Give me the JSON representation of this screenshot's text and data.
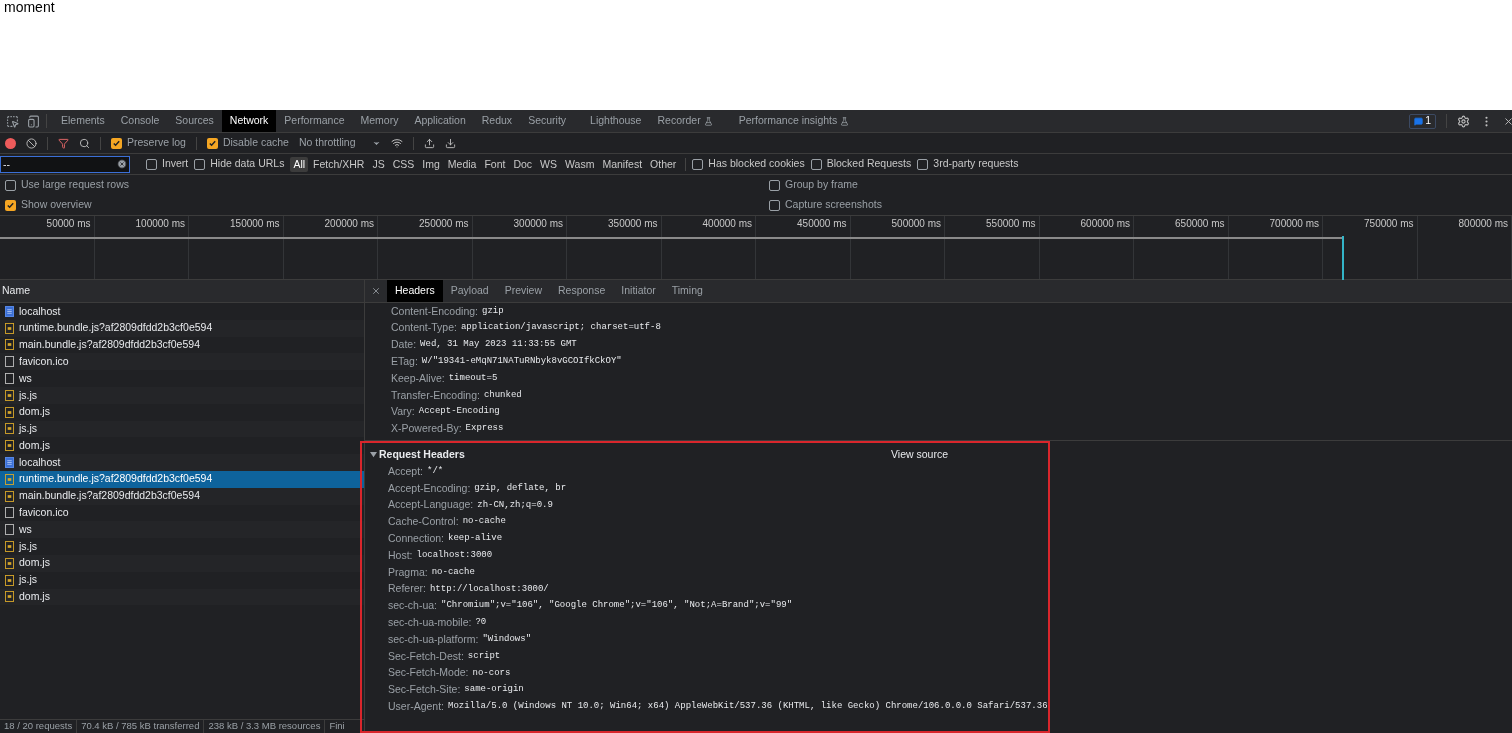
{
  "page": {
    "text": "moment"
  },
  "tabs": [
    {
      "label": "Elements",
      "selected": false,
      "experimental": false
    },
    {
      "label": "Console",
      "selected": false,
      "experimental": false
    },
    {
      "label": "Sources",
      "selected": false,
      "experimental": false
    },
    {
      "label": "Network",
      "selected": true,
      "experimental": false
    },
    {
      "label": "Performance",
      "selected": false,
      "experimental": false
    },
    {
      "label": "Memory",
      "selected": false,
      "experimental": false
    },
    {
      "label": "Application",
      "selected": false,
      "experimental": false
    },
    {
      "label": "Redux",
      "selected": false,
      "experimental": false
    },
    {
      "label": "Security",
      "selected": false,
      "experimental": false
    },
    {
      "label": "Lighthouse",
      "selected": false,
      "experimental": false
    },
    {
      "label": "Recorder",
      "selected": false,
      "experimental": true
    },
    {
      "label": "Performance insights",
      "selected": false,
      "experimental": true
    }
  ],
  "issues_count": "1",
  "toolbar": {
    "recording": true,
    "preserve_log": {
      "label": "Preserve log",
      "checked": true
    },
    "disable_cache": {
      "label": "Disable cache",
      "checked": true
    },
    "throttling": "No throttling"
  },
  "filter": {
    "value": "--",
    "invert": {
      "label": "Invert",
      "checked": false
    },
    "hide_data_urls": {
      "label": "Hide data URLs",
      "checked": false
    },
    "types": [
      {
        "label": "All",
        "selected": true
      },
      {
        "label": "Fetch/XHR",
        "selected": false
      },
      {
        "label": "JS",
        "selected": false
      },
      {
        "label": "CSS",
        "selected": false
      },
      {
        "label": "Img",
        "selected": false
      },
      {
        "label": "Media",
        "selected": false
      },
      {
        "label": "Font",
        "selected": false
      },
      {
        "label": "Doc",
        "selected": false
      },
      {
        "label": "WS",
        "selected": false
      },
      {
        "label": "Wasm",
        "selected": false
      },
      {
        "label": "Manifest",
        "selected": false
      },
      {
        "label": "Other",
        "selected": false
      }
    ],
    "extra": [
      {
        "label": "Has blocked cookies",
        "checked": false
      },
      {
        "label": "Blocked Requests",
        "checked": false
      },
      {
        "label": "3rd-party requests",
        "checked": false
      }
    ]
  },
  "settings_left": [
    {
      "label": "Use large request rows",
      "checked": false
    },
    {
      "label": "Show overview",
      "checked": true
    }
  ],
  "settings_right": [
    {
      "label": "Group by frame",
      "checked": false
    },
    {
      "label": "Capture screenshots",
      "checked": false
    }
  ],
  "timeline_ticks": [
    "50000 ms",
    "100000 ms",
    "150000 ms",
    "200000 ms",
    "250000 ms",
    "300000 ms",
    "350000 ms",
    "400000 ms",
    "450000 ms",
    "500000 ms",
    "550000 ms",
    "600000 ms",
    "650000 ms",
    "700000 ms",
    "750000 ms",
    "800000 ms"
  ],
  "list_header": "Name",
  "requests": [
    {
      "name": "localhost",
      "kind": "doc",
      "selected": false
    },
    {
      "name": "runtime.bundle.js?af2809dfdd2b3cf0e594",
      "kind": "script",
      "selected": false
    },
    {
      "name": "main.bundle.js?af2809dfdd2b3cf0e594",
      "kind": "script",
      "selected": false
    },
    {
      "name": "favicon.ico",
      "kind": "other",
      "selected": false
    },
    {
      "name": "ws",
      "kind": "other",
      "selected": false
    },
    {
      "name": "js.js",
      "kind": "script",
      "selected": false
    },
    {
      "name": "dom.js",
      "kind": "script",
      "selected": false
    },
    {
      "name": "js.js",
      "kind": "script",
      "selected": false
    },
    {
      "name": "dom.js",
      "kind": "script",
      "selected": false
    },
    {
      "name": "localhost",
      "kind": "doc",
      "selected": false
    },
    {
      "name": "runtime.bundle.js?af2809dfdd2b3cf0e594",
      "kind": "script",
      "selected": true
    },
    {
      "name": "main.bundle.js?af2809dfdd2b3cf0e594",
      "kind": "script",
      "selected": false
    },
    {
      "name": "favicon.ico",
      "kind": "other",
      "selected": false
    },
    {
      "name": "ws",
      "kind": "other",
      "selected": false
    },
    {
      "name": "js.js",
      "kind": "script",
      "selected": false
    },
    {
      "name": "dom.js",
      "kind": "script",
      "selected": false
    },
    {
      "name": "js.js",
      "kind": "script",
      "selected": false
    },
    {
      "name": "dom.js",
      "kind": "script",
      "selected": false
    }
  ],
  "status_bar": [
    "18 / 20 requests",
    "70.4 kB / 785 kB transferred",
    "238 kB / 3.3 MB resources",
    "Fini"
  ],
  "detail_tabs": [
    {
      "label": "Headers",
      "selected": true
    },
    {
      "label": "Payload",
      "selected": false
    },
    {
      "label": "Preview",
      "selected": false
    },
    {
      "label": "Response",
      "selected": false
    },
    {
      "label": "Initiator",
      "selected": false
    },
    {
      "label": "Timing",
      "selected": false
    }
  ],
  "response_headers": [
    {
      "name": "Content-Encoding:",
      "value": "gzip"
    },
    {
      "name": "Content-Type:",
      "value": "application/javascript; charset=utf-8"
    },
    {
      "name": "Date:",
      "value": "Wed, 31 May 2023 11:33:55 GMT"
    },
    {
      "name": "ETag:",
      "value": "W/\"19341-eMqN71NATuRNbyk8vGCOIfkCkOY\""
    },
    {
      "name": "Keep-Alive:",
      "value": "timeout=5"
    },
    {
      "name": "Transfer-Encoding:",
      "value": "chunked"
    },
    {
      "name": "Vary:",
      "value": "Accept-Encoding"
    },
    {
      "name": "X-Powered-By:",
      "value": "Express"
    }
  ],
  "request_headers": {
    "title": "Request Headers",
    "expanded": true,
    "view_source": "View source",
    "headers": [
      {
        "name": "Accept:",
        "value": "*/*"
      },
      {
        "name": "Accept-Encoding:",
        "value": "gzip, deflate, br"
      },
      {
        "name": "Accept-Language:",
        "value": "zh-CN,zh;q=0.9"
      },
      {
        "name": "Cache-Control:",
        "value": "no-cache"
      },
      {
        "name": "Connection:",
        "value": "keep-alive"
      },
      {
        "name": "Host:",
        "value": "localhost:3000"
      },
      {
        "name": "Pragma:",
        "value": "no-cache"
      },
      {
        "name": "Referer:",
        "value": "http://localhost:3000/"
      },
      {
        "name": "sec-ch-ua:",
        "value": "\"Chromium\";v=\"106\", \"Google Chrome\";v=\"106\", \"Not;A=Brand\";v=\"99\""
      },
      {
        "name": "sec-ch-ua-mobile:",
        "value": "?0"
      },
      {
        "name": "sec-ch-ua-platform:",
        "value": "\"Windows\""
      },
      {
        "name": "Sec-Fetch-Dest:",
        "value": "script"
      },
      {
        "name": "Sec-Fetch-Mode:",
        "value": "no-cors"
      },
      {
        "name": "Sec-Fetch-Site:",
        "value": "same-origin"
      },
      {
        "name": "User-Agent:",
        "value": "Mozilla/5.0 (Windows NT 10.0; Win64; x64) AppleWebKit/537.36 (KHTML, like Gecko) Chrome/106.0.0.0 Safari/537.36"
      }
    ]
  }
}
